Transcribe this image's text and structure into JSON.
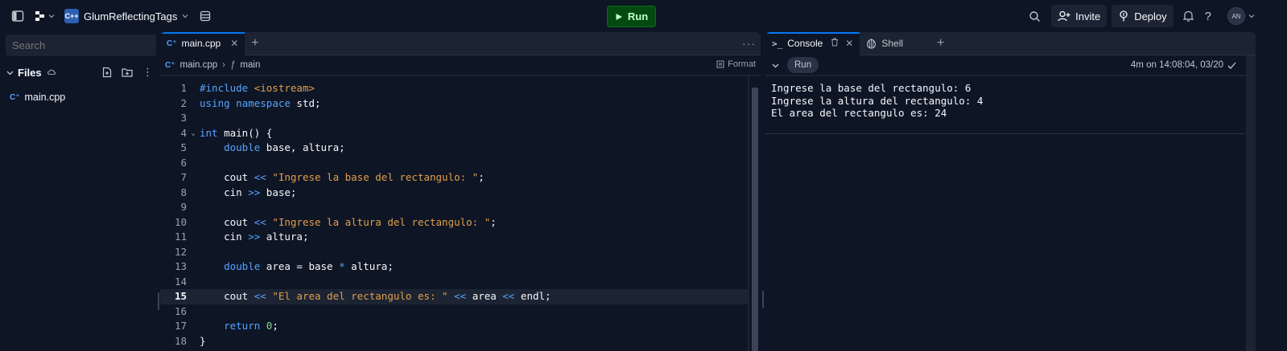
{
  "topbar": {
    "repl_name": "GlumReflectingTags",
    "lang_badge": "C++",
    "run_label": "Run",
    "invite_label": "Invite",
    "deploy_label": "Deploy",
    "avatar_initials": "AN"
  },
  "sidebar": {
    "search_placeholder": "Search",
    "files_title": "Files",
    "files": [
      {
        "name": "main.cpp"
      }
    ]
  },
  "editor": {
    "tab_label": "main.cpp",
    "breadcrumb_file": "main.cpp",
    "breadcrumb_symbol": "main",
    "format_label": "Format",
    "current_line": 15,
    "lines": [
      [
        {
          "t": "#include ",
          "c": "kw"
        },
        {
          "t": "<iostream>",
          "c": "str"
        }
      ],
      [
        {
          "t": "using",
          "c": "kw"
        },
        {
          "t": " "
        },
        {
          "t": "namespace",
          "c": "kw"
        },
        {
          "t": " std;"
        }
      ],
      [],
      [
        {
          "t": "int",
          "c": "kw"
        },
        {
          "t": " "
        },
        {
          "t": "main",
          "c": "fn"
        },
        {
          "t": "() {"
        }
      ],
      [
        {
          "t": "    "
        },
        {
          "t": "double",
          "c": "kw"
        },
        {
          "t": " base, altura;"
        }
      ],
      [],
      [
        {
          "t": "    cout "
        },
        {
          "t": "<<",
          "c": "op"
        },
        {
          "t": " "
        },
        {
          "t": "\"Ingrese la base del rectangulo: \"",
          "c": "str"
        },
        {
          "t": ";"
        }
      ],
      [
        {
          "t": "    cin "
        },
        {
          "t": ">>",
          "c": "op"
        },
        {
          "t": " base;"
        }
      ],
      [],
      [
        {
          "t": "    cout "
        },
        {
          "t": "<<",
          "c": "op"
        },
        {
          "t": " "
        },
        {
          "t": "\"Ingrese la altura del rectangulo: \"",
          "c": "str"
        },
        {
          "t": ";"
        }
      ],
      [
        {
          "t": "    cin "
        },
        {
          "t": ">>",
          "c": "op"
        },
        {
          "t": " altura;"
        }
      ],
      [],
      [
        {
          "t": "    "
        },
        {
          "t": "double",
          "c": "kw"
        },
        {
          "t": " area = base "
        },
        {
          "t": "*",
          "c": "op"
        },
        {
          "t": " altura;"
        }
      ],
      [],
      [
        {
          "t": "    cout "
        },
        {
          "t": "<<",
          "c": "op"
        },
        {
          "t": " "
        },
        {
          "t": "\"El area del rectangulo es: \"",
          "c": "str"
        },
        {
          "t": " "
        },
        {
          "t": "<<",
          "c": "op"
        },
        {
          "t": " area "
        },
        {
          "t": "<<",
          "c": "op"
        },
        {
          "t": " endl;"
        }
      ],
      [],
      [
        {
          "t": "    "
        },
        {
          "t": "return",
          "c": "kw"
        },
        {
          "t": " "
        },
        {
          "t": "0",
          "c": "num"
        },
        {
          "t": ";"
        }
      ],
      [
        {
          "t": "}"
        }
      ]
    ]
  },
  "console": {
    "tabs": [
      {
        "label": "Console"
      },
      {
        "label": "Shell"
      }
    ],
    "run_chip": "Run",
    "status": "4m on 14:08:04, 03/20",
    "output": [
      "Ingrese la base del rectangulo: 6",
      "Ingrese la altura del rectangulo: 4",
      "El area del rectangulo es: 24"
    ]
  },
  "colors": {
    "bg": "#0e1525",
    "panel": "#1c2333",
    "run_green": "#044a10",
    "accent": "#0079f2"
  }
}
